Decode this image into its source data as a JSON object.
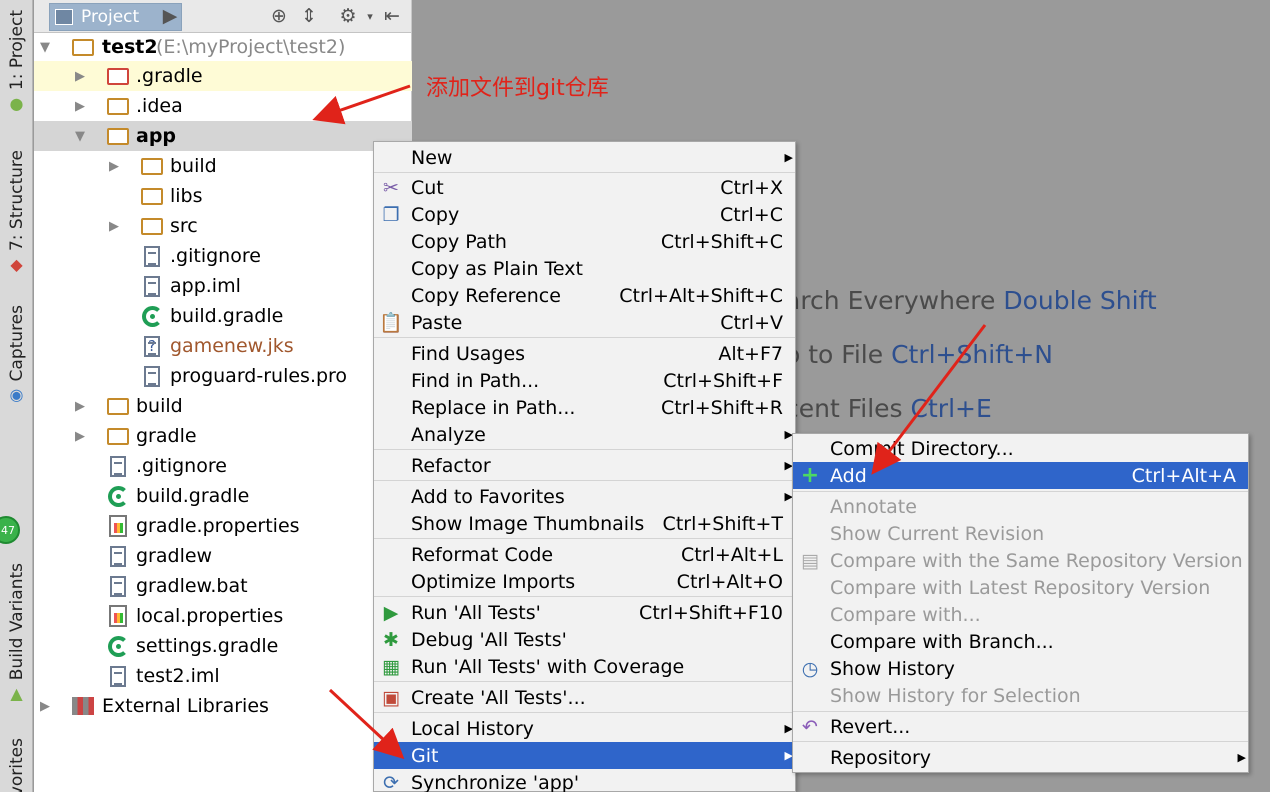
{
  "strip": {
    "tabs": [
      {
        "label": "1: Project"
      },
      {
        "label": "7: Structure"
      },
      {
        "label": "Captures"
      },
      {
        "label": "Build Variants"
      },
      {
        "label": "Favorites"
      }
    ],
    "badge": "47"
  },
  "panel": {
    "tab_label": "Project",
    "tree": [
      {
        "label": "test2",
        "suffix": "(E:\\myProject\\test2)"
      },
      {
        "label": ".gradle"
      },
      {
        "label": ".idea"
      },
      {
        "label": "app"
      },
      {
        "label": "build"
      },
      {
        "label": "libs"
      },
      {
        "label": "src"
      },
      {
        "label": ".gitignore"
      },
      {
        "label": "app.iml"
      },
      {
        "label": "build.gradle"
      },
      {
        "label": "gamenew.jks"
      },
      {
        "label": "proguard-rules.pro"
      },
      {
        "label": "build"
      },
      {
        "label": "gradle"
      },
      {
        "label": ".gitignore"
      },
      {
        "label": "build.gradle"
      },
      {
        "label": "gradle.properties"
      },
      {
        "label": "gradlew"
      },
      {
        "label": "gradlew.bat"
      },
      {
        "label": "local.properties"
      },
      {
        "label": "settings.gradle"
      },
      {
        "label": "test2.iml"
      },
      {
        "label": "External Libraries"
      }
    ]
  },
  "annotation": "添加文件到git仓库",
  "editor_hints": [
    {
      "text": "arch Everywhere ",
      "key": "Double Shift"
    },
    {
      "text": "o to File ",
      "key": "Ctrl+Shift+N"
    },
    {
      "text": "cent Files ",
      "key": "Ctrl+E"
    }
  ],
  "context_menu": [
    {
      "label": "New",
      "shortcut": "",
      "submenu": true
    },
    {
      "label": "Cut",
      "shortcut": "Ctrl+X"
    },
    {
      "label": "Copy",
      "shortcut": "Ctrl+C"
    },
    {
      "label": "Copy Path",
      "shortcut": "Ctrl+Shift+C"
    },
    {
      "label": "Copy as Plain Text",
      "shortcut": ""
    },
    {
      "label": "Copy Reference",
      "shortcut": "Ctrl+Alt+Shift+C"
    },
    {
      "label": "Paste",
      "shortcut": "Ctrl+V"
    },
    {
      "label": "Find Usages",
      "shortcut": "Alt+F7"
    },
    {
      "label": "Find in Path...",
      "shortcut": "Ctrl+Shift+F"
    },
    {
      "label": "Replace in Path...",
      "shortcut": "Ctrl+Shift+R"
    },
    {
      "label": "Analyze",
      "shortcut": "",
      "submenu": true
    },
    {
      "label": "Refactor",
      "shortcut": "",
      "submenu": true
    },
    {
      "label": "Add to Favorites",
      "shortcut": "",
      "submenu": true
    },
    {
      "label": "Show Image Thumbnails",
      "shortcut": "Ctrl+Shift+T"
    },
    {
      "label": "Reformat Code",
      "shortcut": "Ctrl+Alt+L"
    },
    {
      "label": "Optimize Imports",
      "shortcut": "Ctrl+Alt+O"
    },
    {
      "label": "Run 'All Tests'",
      "shortcut": "Ctrl+Shift+F10"
    },
    {
      "label": "Debug 'All Tests'",
      "shortcut": ""
    },
    {
      "label": "Run 'All Tests' with Coverage",
      "shortcut": ""
    },
    {
      "label": "Create 'All Tests'...",
      "shortcut": ""
    },
    {
      "label": "Local History",
      "shortcut": "",
      "submenu": true
    },
    {
      "label": "Git",
      "shortcut": "",
      "submenu": true,
      "selected": true
    },
    {
      "label": "Synchronize 'app'",
      "shortcut": ""
    }
  ],
  "git_menu": [
    {
      "label": "Commit Directory...",
      "shortcut": ""
    },
    {
      "label": "Add",
      "shortcut": "Ctrl+Alt+A",
      "selected": true
    },
    {
      "label": "Annotate",
      "shortcut": "",
      "disabled": true
    },
    {
      "label": "Show Current Revision",
      "shortcut": "",
      "disabled": true
    },
    {
      "label": "Compare with the Same Repository Version",
      "shortcut": "",
      "disabled": true
    },
    {
      "label": "Compare with Latest Repository Version",
      "shortcut": "",
      "disabled": true
    },
    {
      "label": "Compare with...",
      "shortcut": "",
      "disabled": true
    },
    {
      "label": "Compare with Branch...",
      "shortcut": ""
    },
    {
      "label": "Show History",
      "shortcut": ""
    },
    {
      "label": "Show History for Selection",
      "shortcut": "",
      "disabled": true
    },
    {
      "label": "Revert...",
      "shortcut": ""
    },
    {
      "label": "Repository",
      "shortcut": "",
      "submenu": true
    }
  ],
  "colors": {
    "selection": "#2f65ca",
    "annotation": "#e0231a",
    "shortcut_key": "#2d4f8f"
  }
}
